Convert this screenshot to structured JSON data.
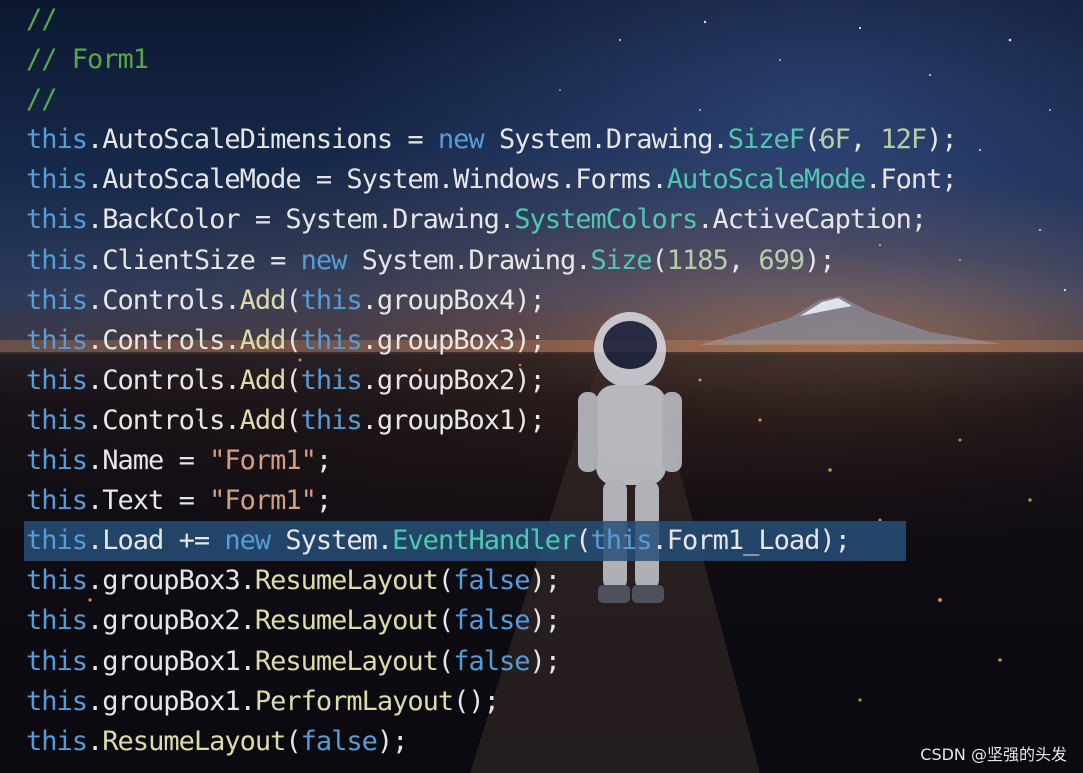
{
  "editor": {
    "language": "csharp",
    "colors": {
      "background": "#0b1220",
      "comment": "#57a64a",
      "keyword": "#569cd6",
      "type": "#4ec9b0",
      "method": "#dcdcaa",
      "string": "#d69d85",
      "number": "#b5cea8",
      "plain": "#e6e6e6",
      "selection": "#264f78"
    },
    "selected_line_index": 13,
    "lines": [
      [
        {
          "t": "//",
          "k": "comment"
        }
      ],
      [
        {
          "t": "// Form1",
          "k": "comment"
        }
      ],
      [
        {
          "t": "//",
          "k": "comment"
        }
      ],
      [
        {
          "t": "this",
          "k": "kw"
        },
        {
          "t": ".AutoScaleDimensions = ",
          "k": "plain"
        },
        {
          "t": "new",
          "k": "kw"
        },
        {
          "t": " System.Drawing.",
          "k": "plain"
        },
        {
          "t": "SizeF",
          "k": "type"
        },
        {
          "t": "(",
          "k": "plain"
        },
        {
          "t": "6F",
          "k": "num"
        },
        {
          "t": ", ",
          "k": "plain"
        },
        {
          "t": "12F",
          "k": "num"
        },
        {
          "t": ");",
          "k": "plain"
        }
      ],
      [
        {
          "t": "this",
          "k": "kw"
        },
        {
          "t": ".AutoScaleMode = System.Windows.Forms.",
          "k": "plain"
        },
        {
          "t": "AutoScaleMode",
          "k": "type"
        },
        {
          "t": ".Font;",
          "k": "plain"
        }
      ],
      [
        {
          "t": "this",
          "k": "kw"
        },
        {
          "t": ".BackColor = System.Drawing.",
          "k": "plain"
        },
        {
          "t": "SystemColors",
          "k": "type"
        },
        {
          "t": ".ActiveCaption;",
          "k": "plain"
        }
      ],
      [
        {
          "t": "this",
          "k": "kw"
        },
        {
          "t": ".ClientSize = ",
          "k": "plain"
        },
        {
          "t": "new",
          "k": "kw"
        },
        {
          "t": " System.Drawing.",
          "k": "plain"
        },
        {
          "t": "Size",
          "k": "type"
        },
        {
          "t": "(",
          "k": "plain"
        },
        {
          "t": "1185",
          "k": "num"
        },
        {
          "t": ", ",
          "k": "plain"
        },
        {
          "t": "699",
          "k": "num"
        },
        {
          "t": ");",
          "k": "plain"
        }
      ],
      [
        {
          "t": "this",
          "k": "kw"
        },
        {
          "t": ".Controls.",
          "k": "plain"
        },
        {
          "t": "Add",
          "k": "method"
        },
        {
          "t": "(",
          "k": "plain"
        },
        {
          "t": "this",
          "k": "kw"
        },
        {
          "t": ".groupBox4);",
          "k": "plain"
        }
      ],
      [
        {
          "t": "this",
          "k": "kw"
        },
        {
          "t": ".Controls.",
          "k": "plain"
        },
        {
          "t": "Add",
          "k": "method"
        },
        {
          "t": "(",
          "k": "plain"
        },
        {
          "t": "this",
          "k": "kw"
        },
        {
          "t": ".groupBox3);",
          "k": "plain"
        }
      ],
      [
        {
          "t": "this",
          "k": "kw"
        },
        {
          "t": ".Controls.",
          "k": "plain"
        },
        {
          "t": "Add",
          "k": "method"
        },
        {
          "t": "(",
          "k": "plain"
        },
        {
          "t": "this",
          "k": "kw"
        },
        {
          "t": ".groupBox2);",
          "k": "plain"
        }
      ],
      [
        {
          "t": "this",
          "k": "kw"
        },
        {
          "t": ".Controls.",
          "k": "plain"
        },
        {
          "t": "Add",
          "k": "method"
        },
        {
          "t": "(",
          "k": "plain"
        },
        {
          "t": "this",
          "k": "kw"
        },
        {
          "t": ".groupBox1);",
          "k": "plain"
        }
      ],
      [
        {
          "t": "this",
          "k": "kw"
        },
        {
          "t": ".Name = ",
          "k": "plain"
        },
        {
          "t": "\"Form1\"",
          "k": "str"
        },
        {
          "t": ";",
          "k": "plain"
        }
      ],
      [
        {
          "t": "this",
          "k": "kw"
        },
        {
          "t": ".Text = ",
          "k": "plain"
        },
        {
          "t": "\"Form1\"",
          "k": "str"
        },
        {
          "t": ";",
          "k": "plain"
        }
      ],
      [
        {
          "t": "this",
          "k": "kw"
        },
        {
          "t": ".Load += ",
          "k": "plain"
        },
        {
          "t": "new",
          "k": "kw"
        },
        {
          "t": " System.",
          "k": "plain"
        },
        {
          "t": "EventHandler",
          "k": "type"
        },
        {
          "t": "(",
          "k": "plain"
        },
        {
          "t": "this",
          "k": "kw"
        },
        {
          "t": ".Form1_Load);",
          "k": "plain"
        }
      ],
      [
        {
          "t": "this",
          "k": "kw"
        },
        {
          "t": ".groupBox3.",
          "k": "plain"
        },
        {
          "t": "ResumeLayout",
          "k": "method"
        },
        {
          "t": "(",
          "k": "plain"
        },
        {
          "t": "false",
          "k": "kw"
        },
        {
          "t": ");",
          "k": "plain"
        }
      ],
      [
        {
          "t": "this",
          "k": "kw"
        },
        {
          "t": ".groupBox2.",
          "k": "plain"
        },
        {
          "t": "ResumeLayout",
          "k": "method"
        },
        {
          "t": "(",
          "k": "plain"
        },
        {
          "t": "false",
          "k": "kw"
        },
        {
          "t": ");",
          "k": "plain"
        }
      ],
      [
        {
          "t": "this",
          "k": "kw"
        },
        {
          "t": ".groupBox1.",
          "k": "plain"
        },
        {
          "t": "ResumeLayout",
          "k": "method"
        },
        {
          "t": "(",
          "k": "plain"
        },
        {
          "t": "false",
          "k": "kw"
        },
        {
          "t": ");",
          "k": "plain"
        }
      ],
      [
        {
          "t": "this",
          "k": "kw"
        },
        {
          "t": ".groupBox1.",
          "k": "plain"
        },
        {
          "t": "PerformLayout",
          "k": "method"
        },
        {
          "t": "();",
          "k": "plain"
        }
      ],
      [
        {
          "t": "this",
          "k": "kw"
        },
        {
          "t": ".",
          "k": "plain"
        },
        {
          "t": "ResumeLayout",
          "k": "method"
        },
        {
          "t": "(",
          "k": "plain"
        },
        {
          "t": "false",
          "k": "kw"
        },
        {
          "t": ");",
          "k": "plain"
        }
      ]
    ]
  },
  "watermark": {
    "text": "CSDN @坚强的头发"
  }
}
